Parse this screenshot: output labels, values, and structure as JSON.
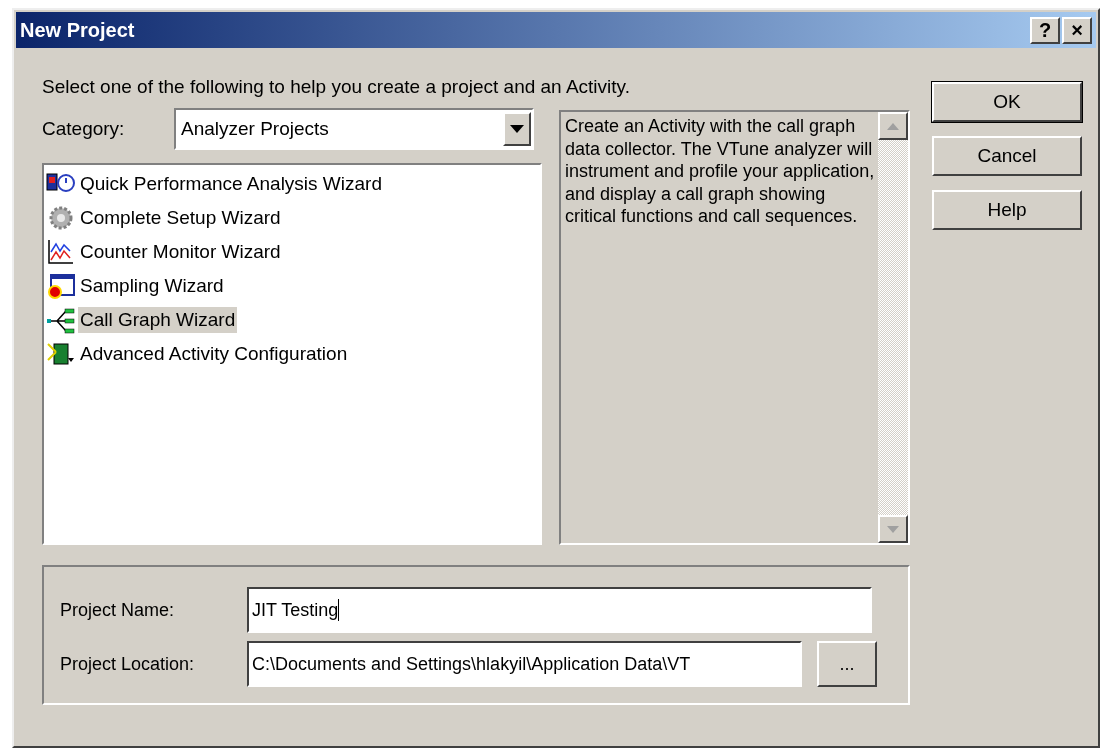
{
  "window": {
    "title": "New Project",
    "title_buttons": [
      "?",
      "×"
    ]
  },
  "instruction": "Select one of the following to help you create a project and an Activity.",
  "category": {
    "label": "Category:",
    "value": "Analyzer Projects"
  },
  "wizards": [
    {
      "label": "Quick Performance Analysis Wizard",
      "kind": "quick",
      "selected": false
    },
    {
      "label": "Complete Setup Wizard",
      "kind": "setup",
      "selected": false
    },
    {
      "label": "Counter Monitor Wizard",
      "kind": "counter",
      "selected": false
    },
    {
      "label": "Sampling Wizard",
      "kind": "sampling",
      "selected": false
    },
    {
      "label": "Call Graph Wizard",
      "kind": "callgraph",
      "selected": true
    },
    {
      "label": "Advanced Activity Configuration",
      "kind": "advanced",
      "selected": false
    }
  ],
  "description": "Create an Activity with the call graph data collector. The VTune analyzer will instrument and profile your application, and display a call graph showing critical functions and call sequences.",
  "buttons": [
    {
      "label": "OK",
      "default": true
    },
    {
      "label": "Cancel",
      "default": false
    },
    {
      "label": "Help",
      "default": false
    }
  ],
  "project_name": {
    "label": "Project Name:",
    "value": "JIT Testing"
  },
  "project_location": {
    "label": "Project Location:",
    "value": "C:\\Documents and Settings\\hlakyil\\Application Data\\VT",
    "browse": "..."
  }
}
